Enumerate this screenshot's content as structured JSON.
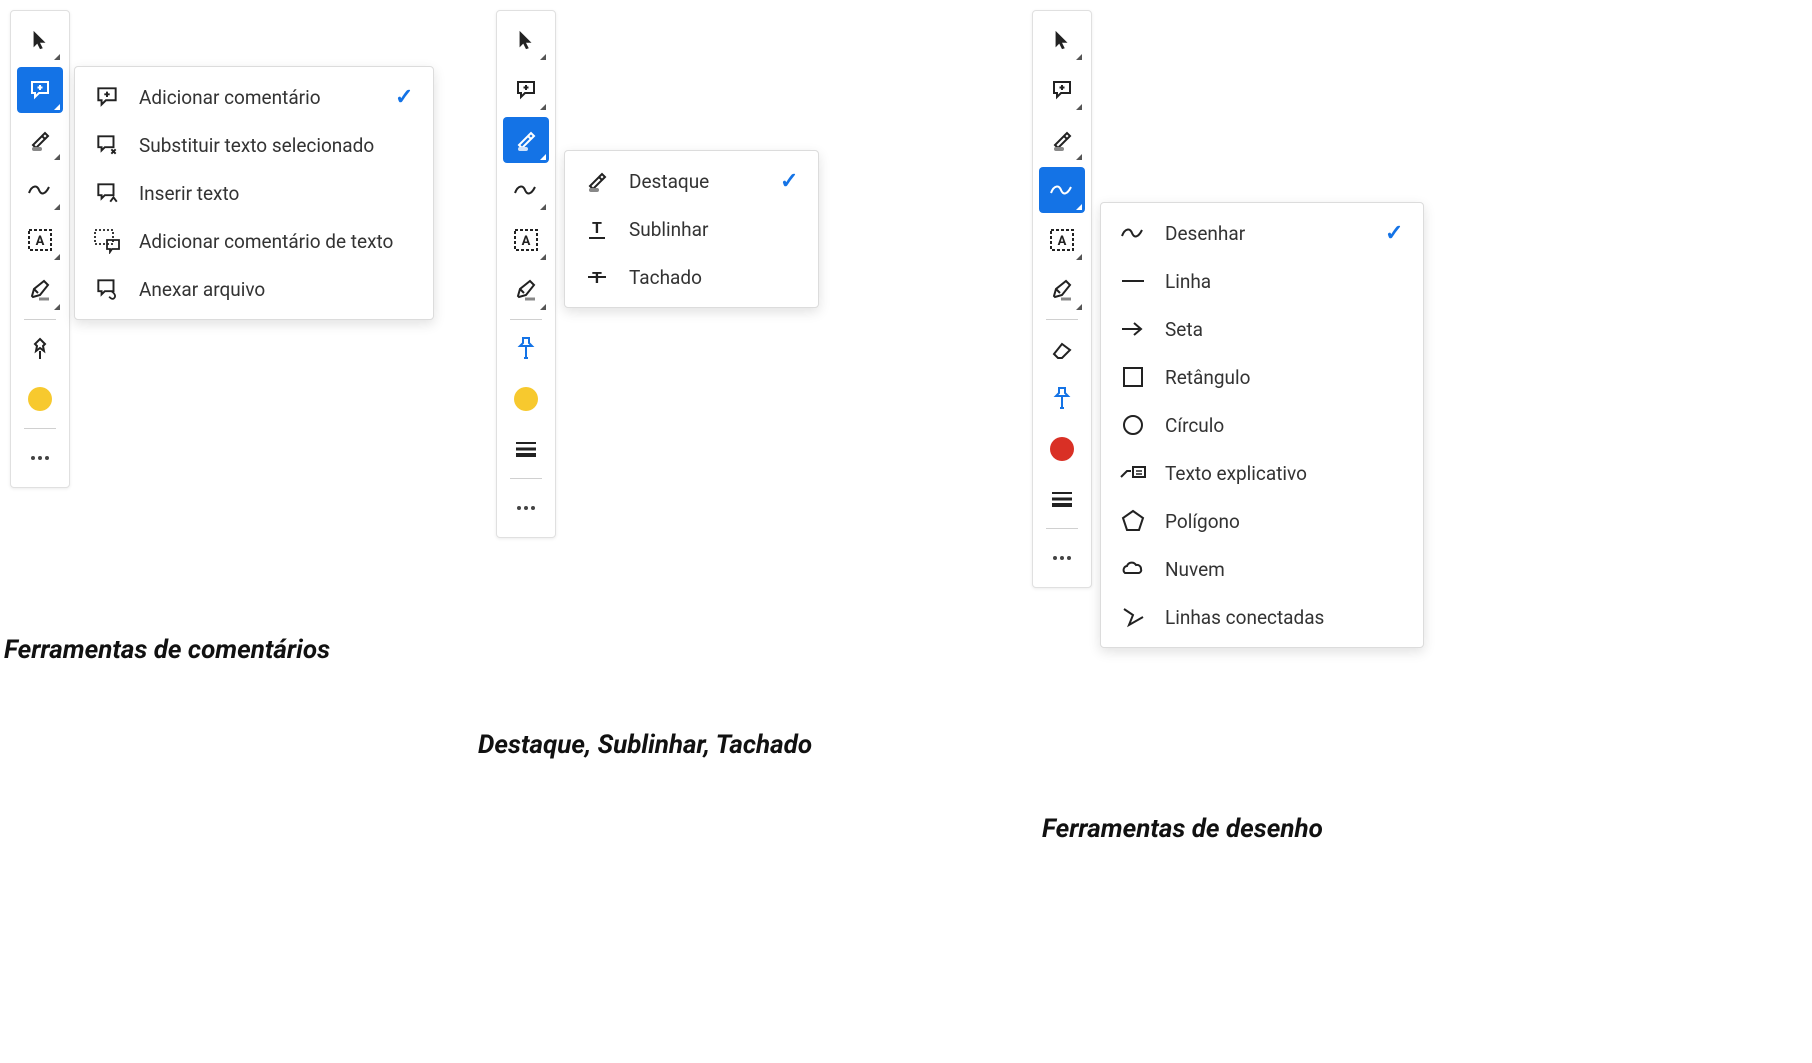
{
  "captions": {
    "comments": "Ferramentas de comentários",
    "highlight": "Destaque, Sublinhar, Tachado",
    "drawing": "Ferramentas de desenho"
  },
  "panel_comments": {
    "flyout": [
      {
        "label": "Adicionar comentário",
        "checked": true
      },
      {
        "label": "Substituir texto selecionado",
        "checked": false
      },
      {
        "label": "Inserir texto",
        "checked": false
      },
      {
        "label": "Adicionar comentário de texto",
        "checked": false
      },
      {
        "label": "Anexar arquivo",
        "checked": false
      }
    ]
  },
  "panel_highlight": {
    "flyout": [
      {
        "label": "Destaque",
        "checked": true
      },
      {
        "label": "Sublinhar",
        "checked": false
      },
      {
        "label": "Tachado",
        "checked": false
      }
    ]
  },
  "panel_drawing": {
    "flyout": [
      {
        "label": "Desenhar",
        "checked": true
      },
      {
        "label": "Linha",
        "checked": false
      },
      {
        "label": "Seta",
        "checked": false
      },
      {
        "label": "Retângulo",
        "checked": false
      },
      {
        "label": "Círculo",
        "checked": false
      },
      {
        "label": "Texto explicativo",
        "checked": false
      },
      {
        "label": "Polígono",
        "checked": false
      },
      {
        "label": "Nuvem",
        "checked": false
      },
      {
        "label": "Linhas conectadas",
        "checked": false
      }
    ]
  },
  "colors": {
    "yellow": "#f7c92e",
    "red": "#d93025",
    "pin_blue": "#1473e6"
  }
}
